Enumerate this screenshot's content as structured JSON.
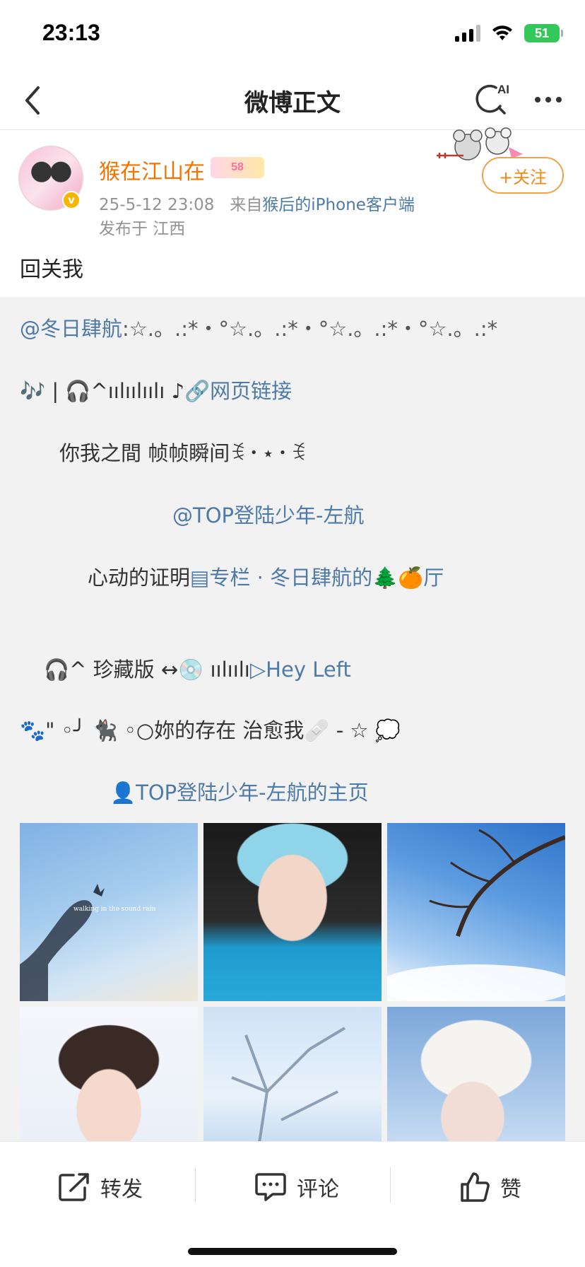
{
  "status_bar": {
    "time": "23:13",
    "battery": "51"
  },
  "nav": {
    "title": "微博正文",
    "ai_label": "AI"
  },
  "author": {
    "name": "猴在江山在",
    "level_badge": "58",
    "timestamp": "25-5-12 23:08",
    "source_prefix": "来自",
    "source": "猴后的iPhone客户端",
    "location": "发布于 江西",
    "follow_label": "+关注"
  },
  "post": {
    "text": "回关我"
  },
  "repost": {
    "line1_mention": "@冬日肆航",
    "line1_rest": ":☆.。.:*・°☆.。.:*・°☆.。.:*・°☆.。.:*",
    "line2_prefix": "🎶 | 🎧^ıılıılıılı ♪",
    "line2_link": "🔗网页链接",
    "line3": "你我之間 帧帧瞬间ꉂ・⋆・ꉂ",
    "line4_mention": "@TOP登陆少年-左航",
    "line5_prefix": "心动的证明",
    "line5_link": "▤专栏 · 冬日肆航的🌲🍊厅",
    "line6_prefix": "🎧^   珍藏版 ↔💿   ıılıılı",
    "line6_link": "▷Hey Left",
    "line7": "🐾\" ◦╯ 🐈‍⬛ ◦○妳的存在 治愈我🩹 - ☆ 💭",
    "line8_link": "👤TOP登陆少年-左航的主页",
    "image1_caption": "walking in the sound rain"
  },
  "actions": {
    "repost": "转发",
    "comment": "评论",
    "like": "赞"
  },
  "colors": {
    "link": "#4e7aa8",
    "author_name": "#f27300",
    "follow": "#f08a18",
    "repost_bg": "#f2f2f2"
  }
}
